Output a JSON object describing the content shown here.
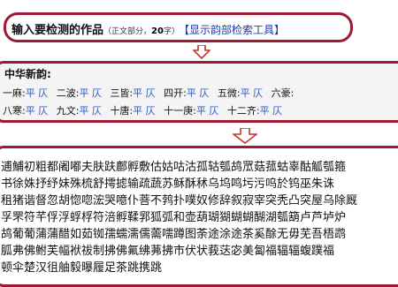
{
  "header": {
    "title": "输入要检测的作品",
    "paren_open": "（正文部分，",
    "count": "20",
    "paren_close": "字）",
    "link": "【显示韵部检索工具】"
  },
  "rhyme": {
    "label": "中华新韵:",
    "row1": [
      {
        "name": "一麻:",
        "p": "平",
        "z": "仄"
      },
      {
        "name": "二波:",
        "p": "平",
        "z": "仄"
      },
      {
        "name": "三皆:",
        "p": "平",
        "z": "仄"
      },
      {
        "name": "四开:",
        "p": "平",
        "z": "仄"
      },
      {
        "name": "五微:",
        "p": "平",
        "z": "仄"
      },
      {
        "name": "六豪:",
        "p": "",
        "z": ""
      }
    ],
    "row2": [
      {
        "name": "八寒:",
        "p": "平",
        "z": "仄"
      },
      {
        "name": "九文:",
        "p": "平",
        "z": "仄"
      },
      {
        "name": "十唐:",
        "p": "平",
        "z": "仄"
      },
      {
        "name": "十一庚:",
        "p": "平",
        "z": "仄"
      },
      {
        "name": "十二齐:",
        "p": "平",
        "z": "仄"
      }
    ]
  },
  "text": {
    "lines": [
      "逋鯆初粗都阇嘟夫肤趺鄜孵敷估姑咕沽孤轱瓠鸪罛菇菰蛄辜酤觚瓠箍",
      "书徐姝抒纾妹殊梳舒摴摅输疏蔬苏稣酥秫乌坞鸣圬污呜於钨巫朱诛",
      "租猪谐督忽胡惚唿浤哭噫仆菩不鹁扑噗奴修辞叙寂宰突秃凸突屋乌除厩",
      "孚罘符芊俘浮蜉桴符涪孵鞣郛狐弧和壶葫瑚猢蝴蝴醐湖瓠箶卢芦垆炉",
      "鸪葡葡蒲蒲醋如茹铷孺蠕濡儒薷嚅蹲图荼途涂途茶奚酴无毋芜吾梧鹉",
      "胍弗佛鲋芙幅袱祓制拂佛氟绋茀拂市伏状莪荙宓美匐福辐辐蝮蹼福",
      "顿伞楚汉徂舳毅曝履足茶跳携跳"
    ]
  }
}
